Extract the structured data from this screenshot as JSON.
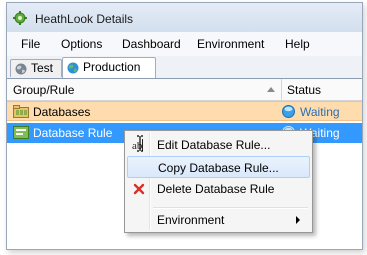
{
  "window": {
    "title": "HeathLook Details"
  },
  "menu": [
    "File",
    "Options",
    "Dashboard",
    "Environment",
    "Help"
  ],
  "tabs": [
    {
      "label": "Test",
      "icon": "globe-icon"
    },
    {
      "label": "Production",
      "icon": "globe-icon",
      "selected": true
    }
  ],
  "grid": {
    "columns": [
      "Group/Rule",
      "Status"
    ],
    "rows": [
      {
        "label": "Databases",
        "status": "Waiting",
        "icon": "database-group-icon"
      },
      {
        "label": "Database Rule",
        "status": "Waiting",
        "icon": "rule-icon",
        "selected": true
      }
    ]
  },
  "context_menu": {
    "items": [
      {
        "label": "Edit Database Rule...",
        "icon": "edit-text-icon"
      },
      {
        "label": "Copy Database Rule...",
        "highlighted": true
      },
      {
        "label": "Delete Database Rule",
        "icon": "delete-x-icon"
      },
      {
        "label": "Environment",
        "submenu": true
      }
    ]
  },
  "colors": {
    "group_row": "#ffdcae",
    "selected_row": "#3399ff",
    "status_text": "#2a6fb5"
  }
}
